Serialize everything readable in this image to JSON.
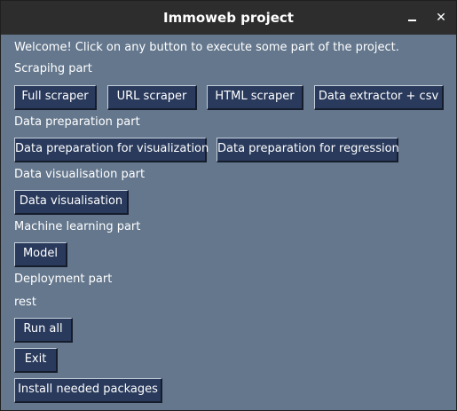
{
  "window": {
    "title": "Immoweb project",
    "minimize_label": "_",
    "close_label": "✕"
  },
  "intro": "Welcome! Click on any button to execute some part of the project.",
  "sections": {
    "scraping": {
      "label": "Scrapihg part",
      "buttons": [
        "Full scraper",
        "URL scraper",
        "HTML scraper",
        "Data extractor + csv"
      ]
    },
    "preparation": {
      "label": "Data preparation part",
      "buttons": [
        "Data preparation for visualization",
        "Data preparation for regression"
      ]
    },
    "visualisation": {
      "label": "Data visualisation part",
      "buttons": [
        "Data visualisation"
      ]
    },
    "ml": {
      "label": "Machine learning part",
      "buttons": [
        "Model"
      ]
    },
    "deployment": {
      "label": "Deployment part"
    },
    "rest": {
      "label": "rest",
      "buttons": [
        "Run all",
        "Exit",
        "Install needed packages"
      ]
    }
  },
  "colors": {
    "background": "#64778d",
    "button": "#293a5c",
    "titlebar": "#2d2d2d",
    "text": "#ffffff"
  }
}
